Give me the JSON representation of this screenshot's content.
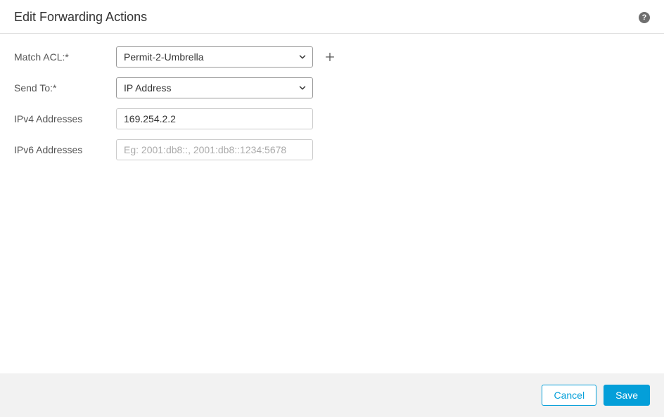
{
  "header": {
    "title": "Edit Forwarding Actions"
  },
  "form": {
    "match_acl": {
      "label": "Match ACL:*",
      "value": "Permit-2-Umbrella"
    },
    "send_to": {
      "label": "Send To:*",
      "value": "IP Address"
    },
    "ipv4": {
      "label": "IPv4 Addresses",
      "value": "169.254.2.2"
    },
    "ipv6": {
      "label": "IPv6 Addresses",
      "value": "",
      "placeholder": "Eg: 2001:db8::, 2001:db8::1234:5678"
    }
  },
  "footer": {
    "cancel": "Cancel",
    "save": "Save"
  }
}
